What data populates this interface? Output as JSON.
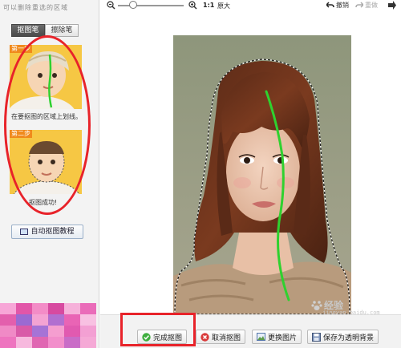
{
  "left_panel": {
    "hint_text": "可以删除重选的区域",
    "modes": [
      "抠图笔",
      "擦除笔"
    ],
    "step1": {
      "tag": "第一步",
      "caption": "在要抠图的区域上划线。"
    },
    "step2": {
      "tag": "第二步",
      "caption": "抠图成功!"
    },
    "auto_button": "自动抠图教程"
  },
  "toolbar": {
    "zoom_ratio": "1:1",
    "zoom_original": "原大",
    "undo": "撤销",
    "redo": "重做"
  },
  "bottom": {
    "finish": "完成抠图",
    "cancel": "取消抠图",
    "change": "更换图片",
    "save": "保存为透明背景"
  },
  "watermark": {
    "brand": "经验",
    "sub": "jingyan.baidu.com"
  },
  "colors": {
    "highlight": "#e8232a",
    "stroke": "#2fd12f",
    "step_bg": "#f6c744",
    "step_tag": "#f08a1c"
  }
}
